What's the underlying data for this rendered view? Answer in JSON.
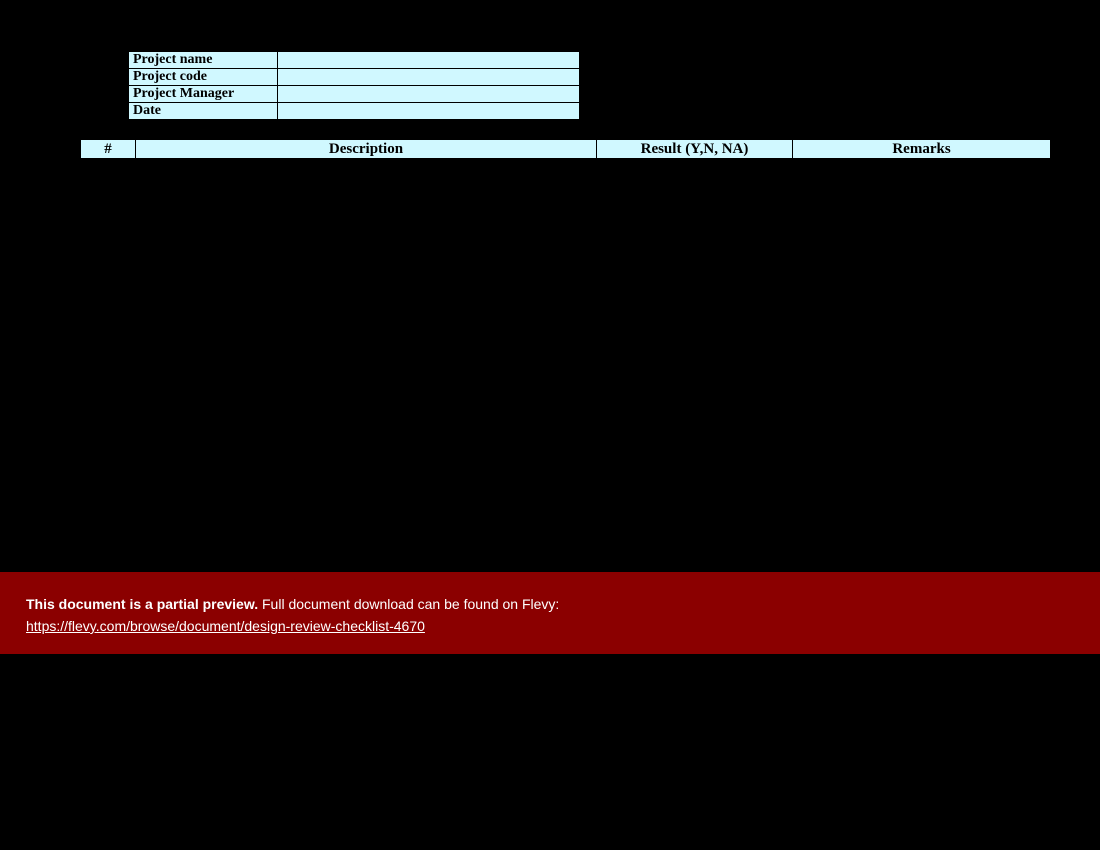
{
  "info": {
    "project_name_label": "Project name",
    "project_name_value": "",
    "project_code_label": "Project code",
    "project_code_value": "",
    "project_manager_label": "Project Manager",
    "project_manager_value": "",
    "date_label": "Date",
    "date_value": ""
  },
  "columns": {
    "num": "#",
    "description": "Description",
    "result": "Result (Y,N, NA)",
    "remarks": "Remarks"
  },
  "banner": {
    "bold_text": "This document is a partial preview.",
    "rest_text": "  Full document download can be found on Flevy:",
    "link_text": "https://flevy.com/browse/document/design-review-checklist-4670"
  }
}
